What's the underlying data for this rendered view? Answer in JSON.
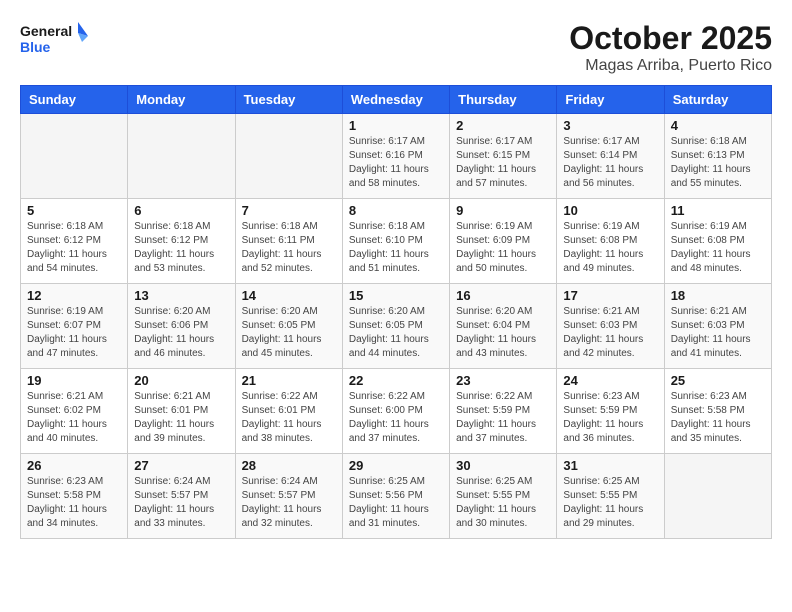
{
  "logo": {
    "line1": "General",
    "line2": "Blue"
  },
  "title": "October 2025",
  "location": "Magas Arriba, Puerto Rico",
  "days_of_week": [
    "Sunday",
    "Monday",
    "Tuesday",
    "Wednesday",
    "Thursday",
    "Friday",
    "Saturday"
  ],
  "weeks": [
    [
      {
        "num": "",
        "sunrise": "",
        "sunset": "",
        "daylight": ""
      },
      {
        "num": "",
        "sunrise": "",
        "sunset": "",
        "daylight": ""
      },
      {
        "num": "",
        "sunrise": "",
        "sunset": "",
        "daylight": ""
      },
      {
        "num": "1",
        "sunrise": "Sunrise: 6:17 AM",
        "sunset": "Sunset: 6:16 PM",
        "daylight": "Daylight: 11 hours and 58 minutes."
      },
      {
        "num": "2",
        "sunrise": "Sunrise: 6:17 AM",
        "sunset": "Sunset: 6:15 PM",
        "daylight": "Daylight: 11 hours and 57 minutes."
      },
      {
        "num": "3",
        "sunrise": "Sunrise: 6:17 AM",
        "sunset": "Sunset: 6:14 PM",
        "daylight": "Daylight: 11 hours and 56 minutes."
      },
      {
        "num": "4",
        "sunrise": "Sunrise: 6:18 AM",
        "sunset": "Sunset: 6:13 PM",
        "daylight": "Daylight: 11 hours and 55 minutes."
      }
    ],
    [
      {
        "num": "5",
        "sunrise": "Sunrise: 6:18 AM",
        "sunset": "Sunset: 6:12 PM",
        "daylight": "Daylight: 11 hours and 54 minutes."
      },
      {
        "num": "6",
        "sunrise": "Sunrise: 6:18 AM",
        "sunset": "Sunset: 6:12 PM",
        "daylight": "Daylight: 11 hours and 53 minutes."
      },
      {
        "num": "7",
        "sunrise": "Sunrise: 6:18 AM",
        "sunset": "Sunset: 6:11 PM",
        "daylight": "Daylight: 11 hours and 52 minutes."
      },
      {
        "num": "8",
        "sunrise": "Sunrise: 6:18 AM",
        "sunset": "Sunset: 6:10 PM",
        "daylight": "Daylight: 11 hours and 51 minutes."
      },
      {
        "num": "9",
        "sunrise": "Sunrise: 6:19 AM",
        "sunset": "Sunset: 6:09 PM",
        "daylight": "Daylight: 11 hours and 50 minutes."
      },
      {
        "num": "10",
        "sunrise": "Sunrise: 6:19 AM",
        "sunset": "Sunset: 6:08 PM",
        "daylight": "Daylight: 11 hours and 49 minutes."
      },
      {
        "num": "11",
        "sunrise": "Sunrise: 6:19 AM",
        "sunset": "Sunset: 6:08 PM",
        "daylight": "Daylight: 11 hours and 48 minutes."
      }
    ],
    [
      {
        "num": "12",
        "sunrise": "Sunrise: 6:19 AM",
        "sunset": "Sunset: 6:07 PM",
        "daylight": "Daylight: 11 hours and 47 minutes."
      },
      {
        "num": "13",
        "sunrise": "Sunrise: 6:20 AM",
        "sunset": "Sunset: 6:06 PM",
        "daylight": "Daylight: 11 hours and 46 minutes."
      },
      {
        "num": "14",
        "sunrise": "Sunrise: 6:20 AM",
        "sunset": "Sunset: 6:05 PM",
        "daylight": "Daylight: 11 hours and 45 minutes."
      },
      {
        "num": "15",
        "sunrise": "Sunrise: 6:20 AM",
        "sunset": "Sunset: 6:05 PM",
        "daylight": "Daylight: 11 hours and 44 minutes."
      },
      {
        "num": "16",
        "sunrise": "Sunrise: 6:20 AM",
        "sunset": "Sunset: 6:04 PM",
        "daylight": "Daylight: 11 hours and 43 minutes."
      },
      {
        "num": "17",
        "sunrise": "Sunrise: 6:21 AM",
        "sunset": "Sunset: 6:03 PM",
        "daylight": "Daylight: 11 hours and 42 minutes."
      },
      {
        "num": "18",
        "sunrise": "Sunrise: 6:21 AM",
        "sunset": "Sunset: 6:03 PM",
        "daylight": "Daylight: 11 hours and 41 minutes."
      }
    ],
    [
      {
        "num": "19",
        "sunrise": "Sunrise: 6:21 AM",
        "sunset": "Sunset: 6:02 PM",
        "daylight": "Daylight: 11 hours and 40 minutes."
      },
      {
        "num": "20",
        "sunrise": "Sunrise: 6:21 AM",
        "sunset": "Sunset: 6:01 PM",
        "daylight": "Daylight: 11 hours and 39 minutes."
      },
      {
        "num": "21",
        "sunrise": "Sunrise: 6:22 AM",
        "sunset": "Sunset: 6:01 PM",
        "daylight": "Daylight: 11 hours and 38 minutes."
      },
      {
        "num": "22",
        "sunrise": "Sunrise: 6:22 AM",
        "sunset": "Sunset: 6:00 PM",
        "daylight": "Daylight: 11 hours and 37 minutes."
      },
      {
        "num": "23",
        "sunrise": "Sunrise: 6:22 AM",
        "sunset": "Sunset: 5:59 PM",
        "daylight": "Daylight: 11 hours and 37 minutes."
      },
      {
        "num": "24",
        "sunrise": "Sunrise: 6:23 AM",
        "sunset": "Sunset: 5:59 PM",
        "daylight": "Daylight: 11 hours and 36 minutes."
      },
      {
        "num": "25",
        "sunrise": "Sunrise: 6:23 AM",
        "sunset": "Sunset: 5:58 PM",
        "daylight": "Daylight: 11 hours and 35 minutes."
      }
    ],
    [
      {
        "num": "26",
        "sunrise": "Sunrise: 6:23 AM",
        "sunset": "Sunset: 5:58 PM",
        "daylight": "Daylight: 11 hours and 34 minutes."
      },
      {
        "num": "27",
        "sunrise": "Sunrise: 6:24 AM",
        "sunset": "Sunset: 5:57 PM",
        "daylight": "Daylight: 11 hours and 33 minutes."
      },
      {
        "num": "28",
        "sunrise": "Sunrise: 6:24 AM",
        "sunset": "Sunset: 5:57 PM",
        "daylight": "Daylight: 11 hours and 32 minutes."
      },
      {
        "num": "29",
        "sunrise": "Sunrise: 6:25 AM",
        "sunset": "Sunset: 5:56 PM",
        "daylight": "Daylight: 11 hours and 31 minutes."
      },
      {
        "num": "30",
        "sunrise": "Sunrise: 6:25 AM",
        "sunset": "Sunset: 5:55 PM",
        "daylight": "Daylight: 11 hours and 30 minutes."
      },
      {
        "num": "31",
        "sunrise": "Sunrise: 6:25 AM",
        "sunset": "Sunset: 5:55 PM",
        "daylight": "Daylight: 11 hours and 29 minutes."
      },
      {
        "num": "",
        "sunrise": "",
        "sunset": "",
        "daylight": ""
      }
    ]
  ]
}
